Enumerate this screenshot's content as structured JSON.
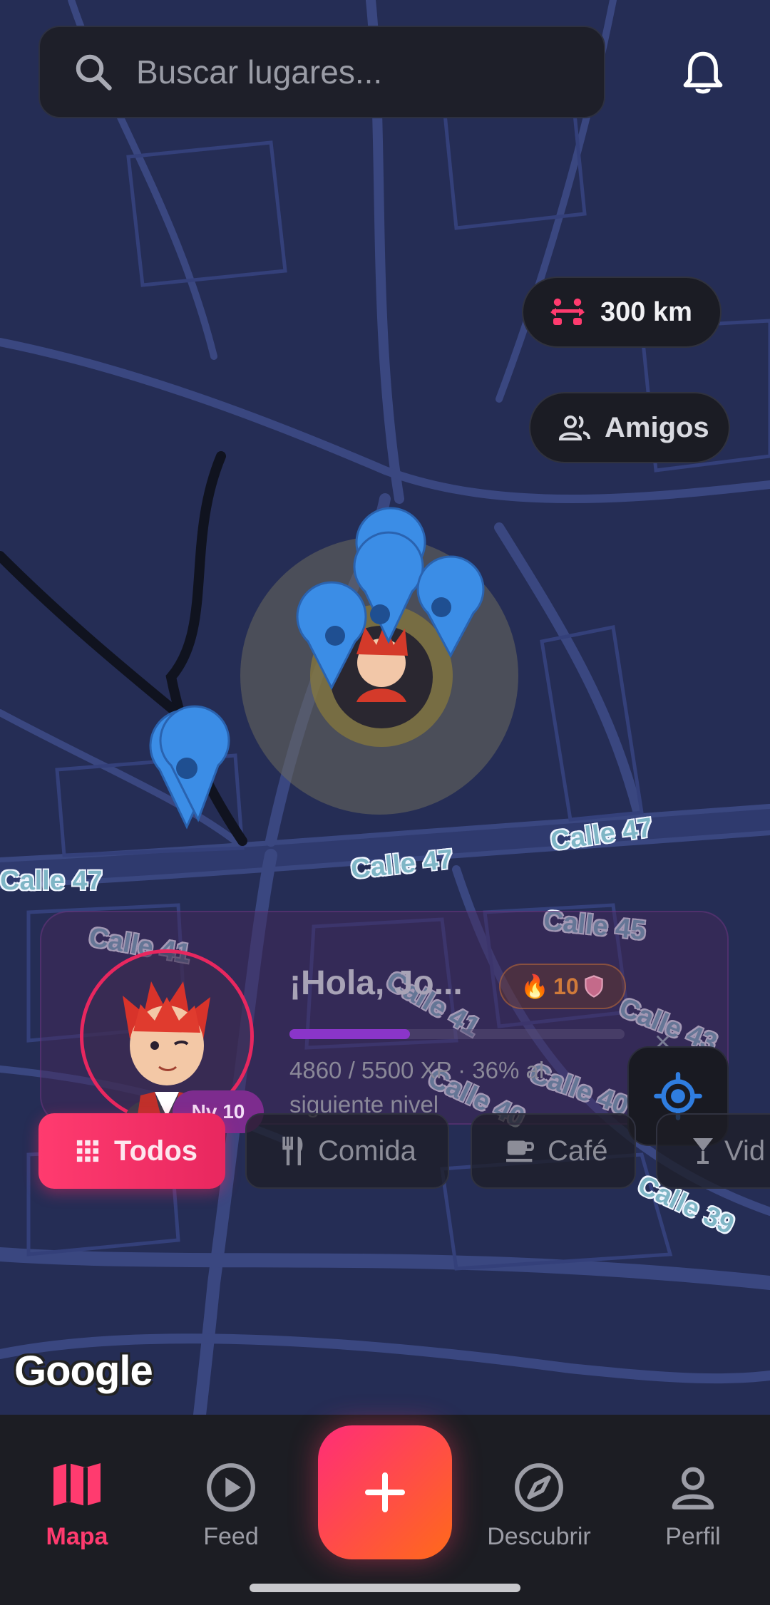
{
  "search": {
    "placeholder": "Buscar lugares..."
  },
  "icons": {
    "search": "search-icon",
    "bell": "bell-icon",
    "distance": "distance-icon",
    "friends": "people-icon",
    "locate": "my-location-icon"
  },
  "filters": {
    "distance_label": "300 km",
    "friends_label": "Amigos"
  },
  "streets": [
    "Calle 47",
    "Calle 47",
    "Calle 47",
    "Calle 41",
    "Calle 45",
    "Calle 41",
    "Calle 43",
    "Calle 40",
    "Calle 40",
    "Calle 39"
  ],
  "profile": {
    "greeting": "¡Hola, Jo...",
    "level": "Nv 10",
    "streak": "10",
    "xp_text": "4860 / 5500 XP · 36% al siguiente nivel",
    "xp_progress": 0.36,
    "close": "×"
  },
  "categories": [
    {
      "label": "Todos",
      "icon": "grid-icon",
      "active": true
    },
    {
      "label": "Comida",
      "icon": "restaurant-icon",
      "active": false
    },
    {
      "label": "Café",
      "icon": "coffee-icon",
      "active": false
    },
    {
      "label": "Vid",
      "icon": "drink-icon",
      "active": false
    }
  ],
  "map_attribution": "Google",
  "nav": {
    "map": "Mapa",
    "feed": "Feed",
    "discover": "Descubrir",
    "profile": "Perfil"
  },
  "colors": {
    "accent": "#ff3b6f",
    "map_bg": "#252d55",
    "road": "#3a4a86"
  }
}
